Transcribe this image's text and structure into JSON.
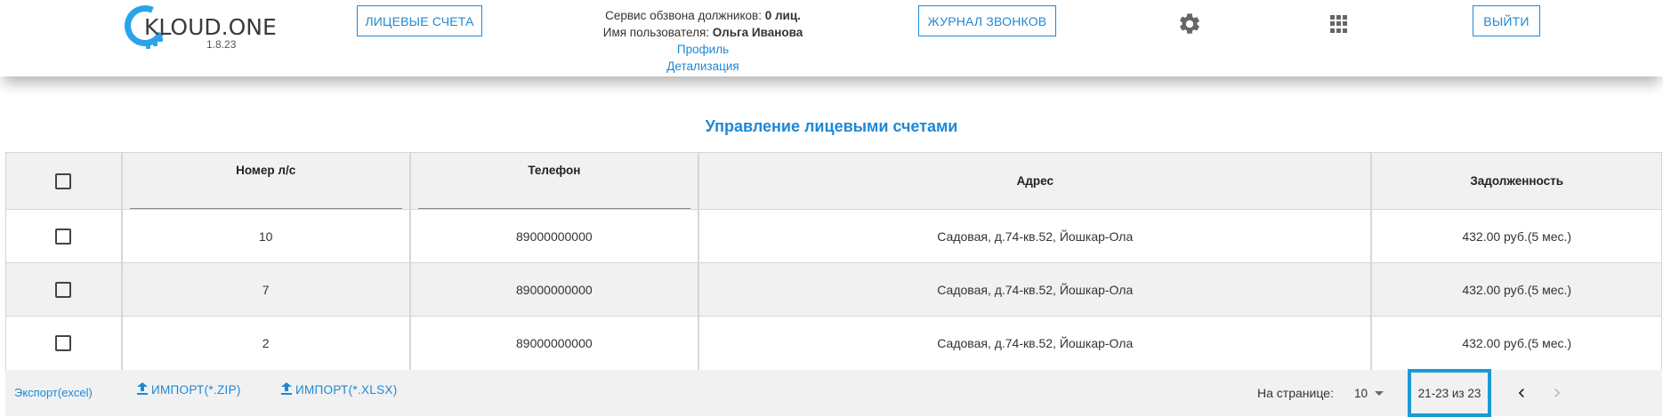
{
  "header": {
    "logo_text": "KLOUD.ONE",
    "logo_version": "1.8.23",
    "accounts_button": "ЛИЦЕВЫЕ СЧЕТА",
    "service_label": "Сервис обзвона должников: ",
    "service_value": "0 лиц.",
    "user_label": "Имя пользователя: ",
    "user_name": "Ольга Иванова",
    "profile_link": "Профиль",
    "details_link": "Детализация",
    "calls_button": "ЖУРНАЛ ЗВОНКОВ",
    "settings_icon": "gear-icon",
    "apps_icon": "apps-grid-icon",
    "logout_button": "ВЫЙТИ"
  },
  "page_title": "Управление лицевыми счетами",
  "table": {
    "columns": [
      "Номер л/с",
      "Телефон",
      "Адрес",
      "Задолженность"
    ],
    "rows": [
      {
        "number": "10",
        "phone": "89000000000",
        "address": "Садовая, д.74-кв.52, Йошкар-Ола",
        "debt": "432.00 руб.(5 мес.)"
      },
      {
        "number": "7",
        "phone": "89000000000",
        "address": "Садовая, д.74-кв.52, Йошкар-Ола",
        "debt": "432.00 руб.(5 мес.)"
      },
      {
        "number": "2",
        "phone": "89000000000",
        "address": "Садовая, д.74-кв.52, Йошкар-Ола",
        "debt": "432.00 руб.(5 мес.)"
      }
    ]
  },
  "footer": {
    "export_link": "Экспорт(excel)",
    "import_zip": "ИМПОРТ(*.ZIP)",
    "import_xlsx": "ИМПОРТ(*.XLSX)",
    "per_page_label": "На странице:",
    "per_page_value": "10",
    "range_text": "21-23 из 23"
  },
  "colors": {
    "accent": "#1e88d6",
    "highlight_border": "#1c9ad6",
    "row_alt": "#f1f1f1"
  }
}
